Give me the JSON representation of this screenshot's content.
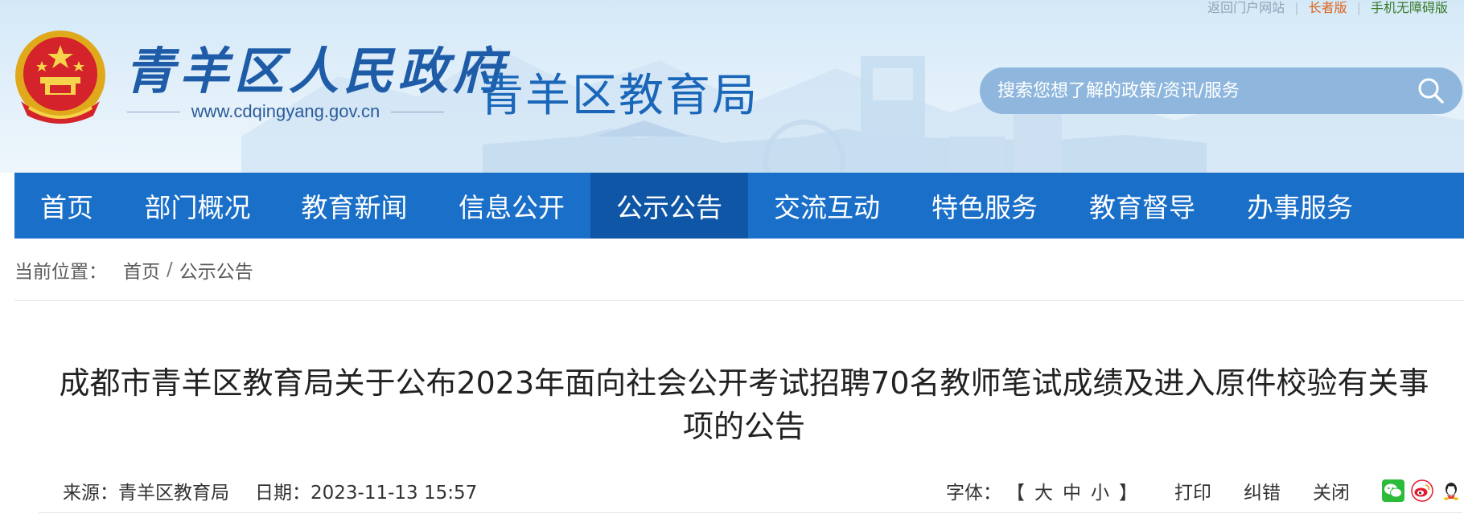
{
  "top_links": {
    "portal": "返回门户网站",
    "elder": "长者版",
    "mobile": "手机无障碍版"
  },
  "header": {
    "gov_name": "青羊区人民政府",
    "gov_url": "www.cdqingyang.gov.cn",
    "bureau_name": "青羊区教育局"
  },
  "search": {
    "placeholder": "搜索您想了解的政策/资讯/服务"
  },
  "nav": {
    "items": [
      {
        "label": "首页"
      },
      {
        "label": "部门概况"
      },
      {
        "label": "教育新闻"
      },
      {
        "label": "信息公开"
      },
      {
        "label": "公示公告"
      },
      {
        "label": "交流互动"
      },
      {
        "label": "特色服务"
      },
      {
        "label": "教育督导"
      },
      {
        "label": "办事服务"
      }
    ],
    "active_index": 4
  },
  "breadcrumb": {
    "prefix": "当前位置：",
    "items": [
      {
        "label": "首页"
      },
      {
        "label": "公示公告"
      }
    ],
    "separator": "/"
  },
  "article": {
    "title_line1": "成都市青羊区教育局关于公布2023年面向社会公开考试招聘70名教师笔试成绩及进入原件校验有关事",
    "title_line2": "项的公告",
    "source_label": "来源：",
    "source_value": "青羊区教育局",
    "date_label": "日期：",
    "date_value": "2023-11-13 15:57"
  },
  "tools": {
    "font_label": "字体：",
    "bracket_open": "【",
    "bracket_close": "】",
    "font_large": "大",
    "font_medium": "中",
    "font_small": "小",
    "print": "打印",
    "error": "纠错",
    "close": "关闭"
  },
  "colors": {
    "nav_bg": "#1a6fc9",
    "nav_active": "#0f56a6",
    "brand_blue": "#1a66b8",
    "elder_orange": "#e0641a",
    "mobile_green": "#3a7b2a"
  },
  "icons": {
    "emblem": "national-emblem-icon",
    "search": "search-icon",
    "wechat": "wechat-icon",
    "weibo": "weibo-icon",
    "qq": "qq-icon"
  }
}
